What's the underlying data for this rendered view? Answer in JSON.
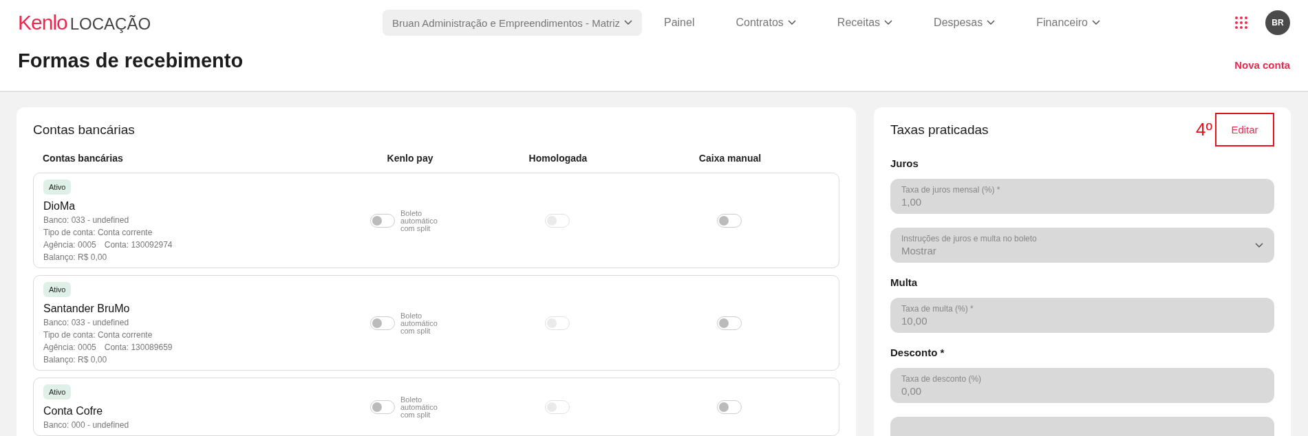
{
  "brand": {
    "logo": "Kenlo",
    "product": "LOCAÇÃO"
  },
  "nav": {
    "company": "Bruan Administração e Empreendimentos - Matriz",
    "items": [
      {
        "label": "Painel",
        "has_menu": false
      },
      {
        "label": "Contratos",
        "has_menu": true
      },
      {
        "label": "Receitas",
        "has_menu": true
      },
      {
        "label": "Despesas",
        "has_menu": true
      },
      {
        "label": "Financeiro",
        "has_menu": true
      }
    ],
    "user": {
      "initials": "BR"
    }
  },
  "page": {
    "title": "Formas de recebimento",
    "action": "Nova conta"
  },
  "accounts": {
    "title": "Contas bancárias",
    "columns": [
      "Contas bancárias",
      "Kenlo pay",
      "Homologada",
      "Caixa manual"
    ],
    "rows": [
      {
        "status": "Ativo",
        "name": "DioMa",
        "details": [
          [
            "Banco: 033 - undefined"
          ],
          [
            "Tipo de conta: Conta corrente"
          ],
          [
            "Agência: 0005",
            "Conta: 130092974"
          ],
          [
            "Balanço: R$ 0,00"
          ]
        ],
        "kenlo_pay": {
          "on": false,
          "disabled": false,
          "caption": "Boleto automático com split"
        },
        "homologada": {
          "on": false,
          "disabled": true
        },
        "caixa_manual": {
          "on": false,
          "disabled": false
        }
      },
      {
        "status": "Ativo",
        "name": "Santander BruMo",
        "details": [
          [
            "Banco: 033 - undefined"
          ],
          [
            "Tipo de conta: Conta corrente"
          ],
          [
            "Agência: 0005",
            "Conta: 130089659"
          ],
          [
            "Balanço: R$ 0,00"
          ]
        ],
        "kenlo_pay": {
          "on": false,
          "disabled": false,
          "caption": "Boleto automático com split"
        },
        "homologada": {
          "on": false,
          "disabled": true
        },
        "caixa_manual": {
          "on": false,
          "disabled": false
        }
      },
      {
        "status": "Ativo",
        "name": "Conta Cofre",
        "details": [
          [
            "Banco: 000 - undefined"
          ]
        ],
        "kenlo_pay": {
          "on": false,
          "disabled": false,
          "caption": "Boleto automático com split"
        },
        "homologada": {
          "on": false,
          "disabled": true
        },
        "caixa_manual": {
          "on": false,
          "disabled": false
        }
      }
    ]
  },
  "rates": {
    "title": "Taxas praticadas",
    "annotation": "4º",
    "edit": "Editar",
    "sections": [
      {
        "heading": "Juros",
        "fields": [
          {
            "kind": "input",
            "disabled": true,
            "label": "Taxa de juros mensal (%) *",
            "value": "1,00"
          },
          {
            "kind": "select",
            "disabled": true,
            "label": "Instruções de juros e multa no boleto",
            "value": "Mostrar"
          }
        ]
      },
      {
        "heading": "Multa",
        "fields": [
          {
            "kind": "input",
            "disabled": true,
            "label": "Taxa de multa (%) *",
            "value": "10,00"
          }
        ]
      },
      {
        "heading": "Desconto *",
        "fields": [
          {
            "kind": "input",
            "disabled": true,
            "label": "Taxa de desconto (%)",
            "value": "0,00"
          },
          {
            "kind": "input",
            "disabled": true
          }
        ]
      }
    ]
  }
}
